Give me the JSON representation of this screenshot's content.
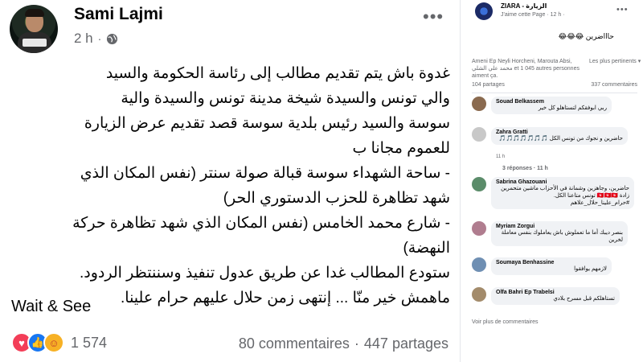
{
  "post": {
    "author": "Sami Lajmi",
    "time": "2 h",
    "separator": "·",
    "lines": [
      "غدوة باش يتم تقديم مطالب إلى رئاسة الحكومة والسيد",
      "والي تونس والسيدة شيخة مدينة تونس والسيدة والية",
      "سوسة والسيد رئيس بلدية سوسة قصد تقديم عرض الزيارة",
      "للعموم مجانا ب",
      "- ساحة الشهداء سوسة قبالة صولة سنتر (نفس المكان الذي",
      "شهد تظاهرة للحزب الدستوري الحر)",
      "- شارع محمد الخامس (نفس المكان الذي شهد تظاهرة حركة",
      "النهضة)",
      "ستودع المطالب غدا عن طريق عدول تنفيذ وسننتظر الردود.",
      "ماهمش خير منّا ... إنتهى زمن حلال عليهم حرام علينا."
    ],
    "signoff": "Wait & See",
    "reaction_count": "1 574",
    "comments_count": "80 commentaires",
    "shares_count": "447 partages",
    "more_icon": "ellipsis-icon",
    "privacy_icon": "globe-icon"
  },
  "side": {
    "page_name": "ZIARA - الزيارة",
    "page_meta": "J'aime cette Page · 12 h ·",
    "caption": "حاااضرين 😂😂😂",
    "likers": "Ameni Ep Neyli Horcheni, Marouta Absi, محمد علي الشلي et 1 045 autres personnes aiment ça.",
    "sort_label": "Les plus pertinents ▾",
    "shares": "104 partages",
    "comments": "337 commentaires",
    "see_more": "Voir plus de commentaires",
    "replies_label": "3 réponses · 11 h",
    "comment_list": [
      {
        "name": "Souad Belkassem",
        "text": "ربي ابوفقكم لتستاهلو كل خير",
        "time": ""
      },
      {
        "name": "Zahra Gratti",
        "text": "حاضرين و نجوك من تونس الكل 🎵🎵🎵🎵🎵🎵🎵",
        "time": "11 h"
      },
      {
        "name": "Sabrina Ghazouani",
        "text": "حاضرين، وجاهزين وشمانة في الأحزاب ماشين متحمرين زادة 🇹🇳🇹🇳🇹🇳 تونس متاعنا الكل. #حرام_علينا_حلال_علاهم",
        "time": ""
      },
      {
        "name": "Myriam Zorgui",
        "text": "بنصر ديبك أما ما تعملوش باش يعاملوك بنفس معاملة لخرين",
        "time": ""
      },
      {
        "name": "Soumaya Benhassine",
        "text": "لازمهم يوافقوا",
        "time": ""
      },
      {
        "name": "Olfa Bahri Ep Trabelsi",
        "text": "تستاهلكم قبل مسرح بلادي",
        "time": ""
      }
    ],
    "colors": {
      "love": "#f33e58",
      "like": "#1877f2",
      "care": "#f7b125"
    }
  }
}
